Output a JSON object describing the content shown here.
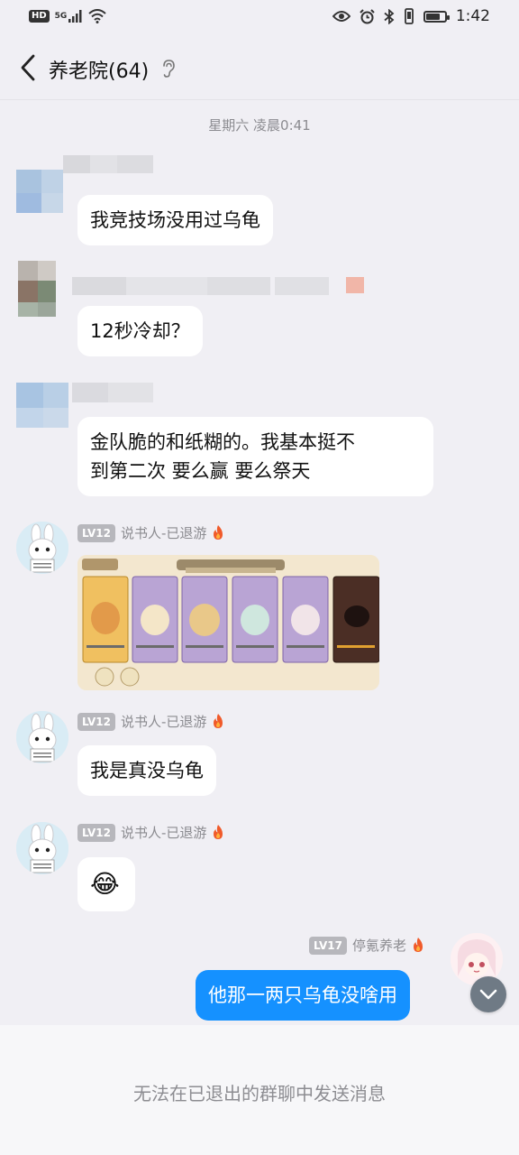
{
  "status_bar": {
    "hd": "HD",
    "net": "5G",
    "time": "1:42",
    "battery_level": 0.85,
    "icons": [
      "hd-icon",
      "signal-icon",
      "wifi-icon",
      "eye-icon",
      "alarm-icon",
      "bluetooth-icon",
      "vibrate-icon",
      "battery-icon"
    ]
  },
  "header": {
    "back_icon": "chevron-left-icon",
    "title": "养老院(64)",
    "title_icon": "ear-icon"
  },
  "chat": {
    "timestamp": "星期六 凌晨0:41",
    "messages": [
      {
        "text": "我竞技场没用过乌龟"
      },
      {
        "text": "12秒冷却？"
      },
      {
        "line1": "金队脆的和纸糊的。我基本挺不",
        "line2": "到第二次 要么赢 要么祭天"
      },
      {
        "level": "LV12",
        "sender": "说书人-已退游",
        "image": "game-screenshot"
      },
      {
        "level": "LV12",
        "sender": "说书人-已退游",
        "text": "我是真没乌龟"
      },
      {
        "level": "LV12",
        "sender": "说书人-已退游",
        "emoji": "😂"
      },
      {
        "level": "LV17",
        "sender": "停氪养老",
        "text": "他那一两只乌龟没啥用"
      }
    ]
  },
  "footer": {
    "notice": "无法在已退出的群聊中发送消息"
  },
  "colors": {
    "background": "#f0eff4",
    "my_bubble": "#1591ff",
    "level_badge": "#b7b7bc",
    "flame": "#f05a2a"
  }
}
